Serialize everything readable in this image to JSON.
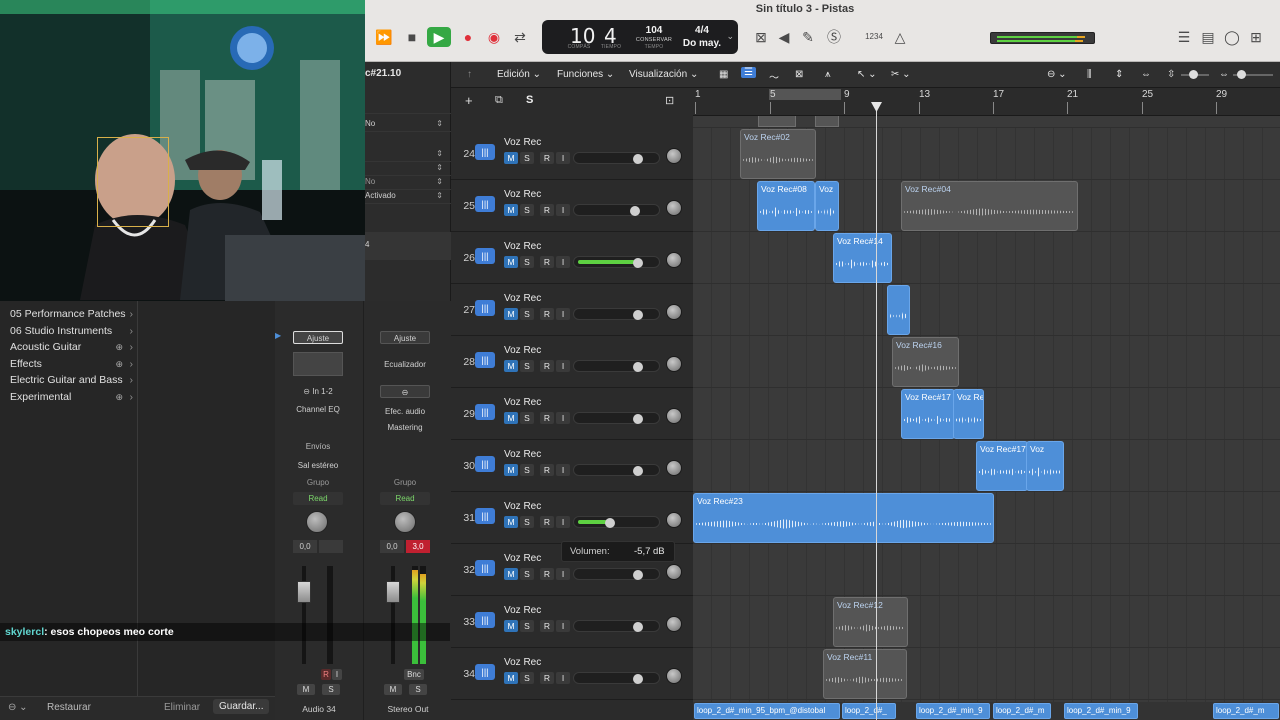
{
  "window": {
    "title": "Sin título 3 - Pistas"
  },
  "lcd": {
    "bars": "10",
    "beat": "4",
    "bars_cap": "COMPÁS",
    "beat_cap": "TIEMPO",
    "tempo": "104",
    "tempo_mode": "CONSERVAR",
    "tempo_cap": "TEMPO",
    "signature": "4/4",
    "key": "Do may."
  },
  "toolbar": {
    "counter": "1234"
  },
  "colors": {
    "accent": "#4e8fd8",
    "play": "#35a844",
    "record": "#e0303a",
    "meter_green": "#5ed142"
  },
  "library": {
    "items": [
      {
        "label": "05 Performance Patches",
        "download": false
      },
      {
        "label": "06 Studio Instruments",
        "download": false
      },
      {
        "label": "Acoustic Guitar",
        "download": true
      },
      {
        "label": "Effects",
        "download": true
      },
      {
        "label": "Electric Guitar and Bass",
        "download": false
      },
      {
        "label": "Experimental",
        "download": true
      }
    ],
    "footer": {
      "restore": "Restaurar",
      "delete": "Eliminar",
      "save": "Guardar..."
    }
  },
  "chat": {
    "user": "skylercl",
    "message": ": esos chopeos meo corte"
  },
  "inspector": {
    "region_name": "c#21.10",
    "rows": [
      "No",
      "No",
      "Activado"
    ],
    "num": "4"
  },
  "strips": [
    {
      "name": "Audio 34",
      "setting": "Ajuste",
      "input": "In 1-2",
      "eq": "Channel EQ",
      "sends": "Envíos",
      "output": "Sal estéreo",
      "group": "Grupo",
      "automation": "Read",
      "pan_val": "0,0",
      "peak": "",
      "r": "R",
      "i": "I",
      "m": "M",
      "s": "S"
    },
    {
      "name": "Stereo Out",
      "setting": "Ajuste",
      "eq": "Ecualizador",
      "fx": "Efec. audio",
      "mastering": "Mastering",
      "group": "Grupo",
      "automation": "Read",
      "pan_val": "0,0",
      "peak": "3,0",
      "bnc": "Bnc",
      "m": "M",
      "s": "S"
    }
  ],
  "tracks_header": {
    "menus": [
      "Edición",
      "Funciones",
      "Visualización"
    ],
    "s_label": "S"
  },
  "ruler": {
    "marks": [
      "1",
      "5",
      "9",
      "13",
      "17",
      "21",
      "25",
      "29"
    ]
  },
  "tracks": [
    {
      "num": "24",
      "name": "Voz Rec",
      "m": "M",
      "s": "S",
      "r": "R",
      "i": "I",
      "volume": 0.78,
      "active": false
    },
    {
      "num": "25",
      "name": "Voz Rec",
      "m": "M",
      "s": "S",
      "r": "R",
      "i": "I",
      "volume": 0.74,
      "active": false
    },
    {
      "num": "26",
      "name": "Voz Rec",
      "m": "M",
      "s": "S",
      "r": "R",
      "i": "I",
      "volume": 0.78,
      "active": true
    },
    {
      "num": "27",
      "name": "Voz Rec",
      "m": "M",
      "s": "S",
      "r": "R",
      "i": "I",
      "volume": 0.78,
      "active": false
    },
    {
      "num": "28",
      "name": "Voz Rec",
      "m": "M",
      "s": "S",
      "r": "R",
      "i": "I",
      "volume": 0.78,
      "active": false
    },
    {
      "num": "29",
      "name": "Voz Rec",
      "m": "M",
      "s": "S",
      "r": "R",
      "i": "I",
      "volume": 0.78,
      "active": false
    },
    {
      "num": "30",
      "name": "Voz Rec",
      "m": "M",
      "s": "S",
      "r": "R",
      "i": "I",
      "volume": 0.78,
      "active": false
    },
    {
      "num": "31",
      "name": "Voz Rec",
      "m": "M",
      "s": "S",
      "r": "R",
      "i": "I",
      "volume": 0.4,
      "active": true
    },
    {
      "num": "32",
      "name": "Voz Rec",
      "m": "M",
      "s": "S",
      "r": "R",
      "i": "I",
      "volume": 0.78,
      "active": false
    },
    {
      "num": "33",
      "name": "Voz Rec",
      "m": "M",
      "s": "S",
      "r": "R",
      "i": "I",
      "volume": 0.78,
      "active": false
    },
    {
      "num": "34",
      "name": "Voz Rec",
      "m": "M",
      "s": "S",
      "r": "R",
      "i": "I",
      "volume": 0.78,
      "active": false
    }
  ],
  "regions": [
    {
      "label": "Voz Rec#02",
      "style": "gray"
    },
    {
      "label": "Voz Rec#08",
      "style": "blue"
    },
    {
      "label": "Voz",
      "style": "blue"
    },
    {
      "label": "Voz Rec#04",
      "style": "gray"
    },
    {
      "label": "Voz Rec#14",
      "style": "blue"
    },
    {
      "label": "",
      "style": "blue"
    },
    {
      "label": "Voz Rec#16",
      "style": "gray"
    },
    {
      "label": "Voz Rec#17",
      "style": "blue"
    },
    {
      "label": "Voz Re",
      "style": "blue"
    },
    {
      "label": "Voz Rec#17.",
      "style": "blue"
    },
    {
      "label": "Voz",
      "style": "blue"
    },
    {
      "label": "Voz Rec#23",
      "style": "blue"
    },
    {
      "label": "Voz Rec#12",
      "style": "gray"
    },
    {
      "label": "Voz Rec#11",
      "style": "gray"
    }
  ],
  "loops": [
    "loop_2_d#_min_95_bpm_@distobal",
    "loop_2_d#_",
    "loop_2_d#_min_9",
    "loop_2_d#_m",
    "loop_2_d#_min_9",
    "loop_2_d#_m"
  ],
  "tooltip": {
    "label": "Volumen:",
    "value": "-5,7 dB"
  }
}
